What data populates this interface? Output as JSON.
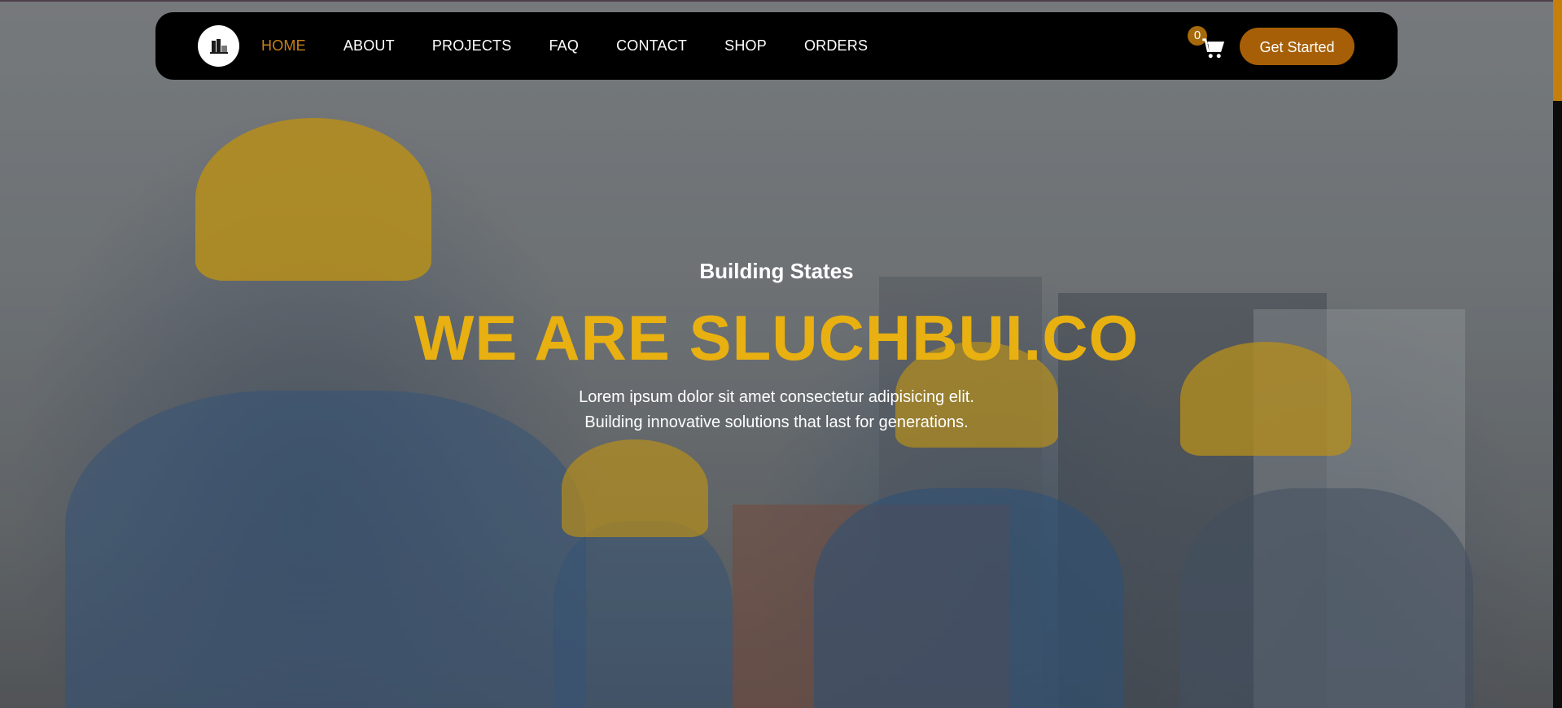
{
  "nav": {
    "logo": "company-logo-icon",
    "links": [
      {
        "label": "HOME",
        "active": true
      },
      {
        "label": "ABOUT"
      },
      {
        "label": "PROJECTS"
      },
      {
        "label": "FAQ"
      },
      {
        "label": "CONTACT"
      },
      {
        "label": "SHOP"
      },
      {
        "label": "ORDERS"
      }
    ],
    "cart_count": "0",
    "cart_icon": "shopping-cart-icon",
    "cta_label": "Get Started"
  },
  "hero": {
    "subtitle": "Building States",
    "headline": "WE ARE SLUCHBUI.CO",
    "description": "Lorem ipsum dolor sit amet consectetur adipisicing elit. Building innovative solutions that last for generations."
  },
  "colors": {
    "accent": "#c8801a",
    "cta": "#a65f07",
    "headline": "#e8b010",
    "nav_bg": "#000000"
  }
}
